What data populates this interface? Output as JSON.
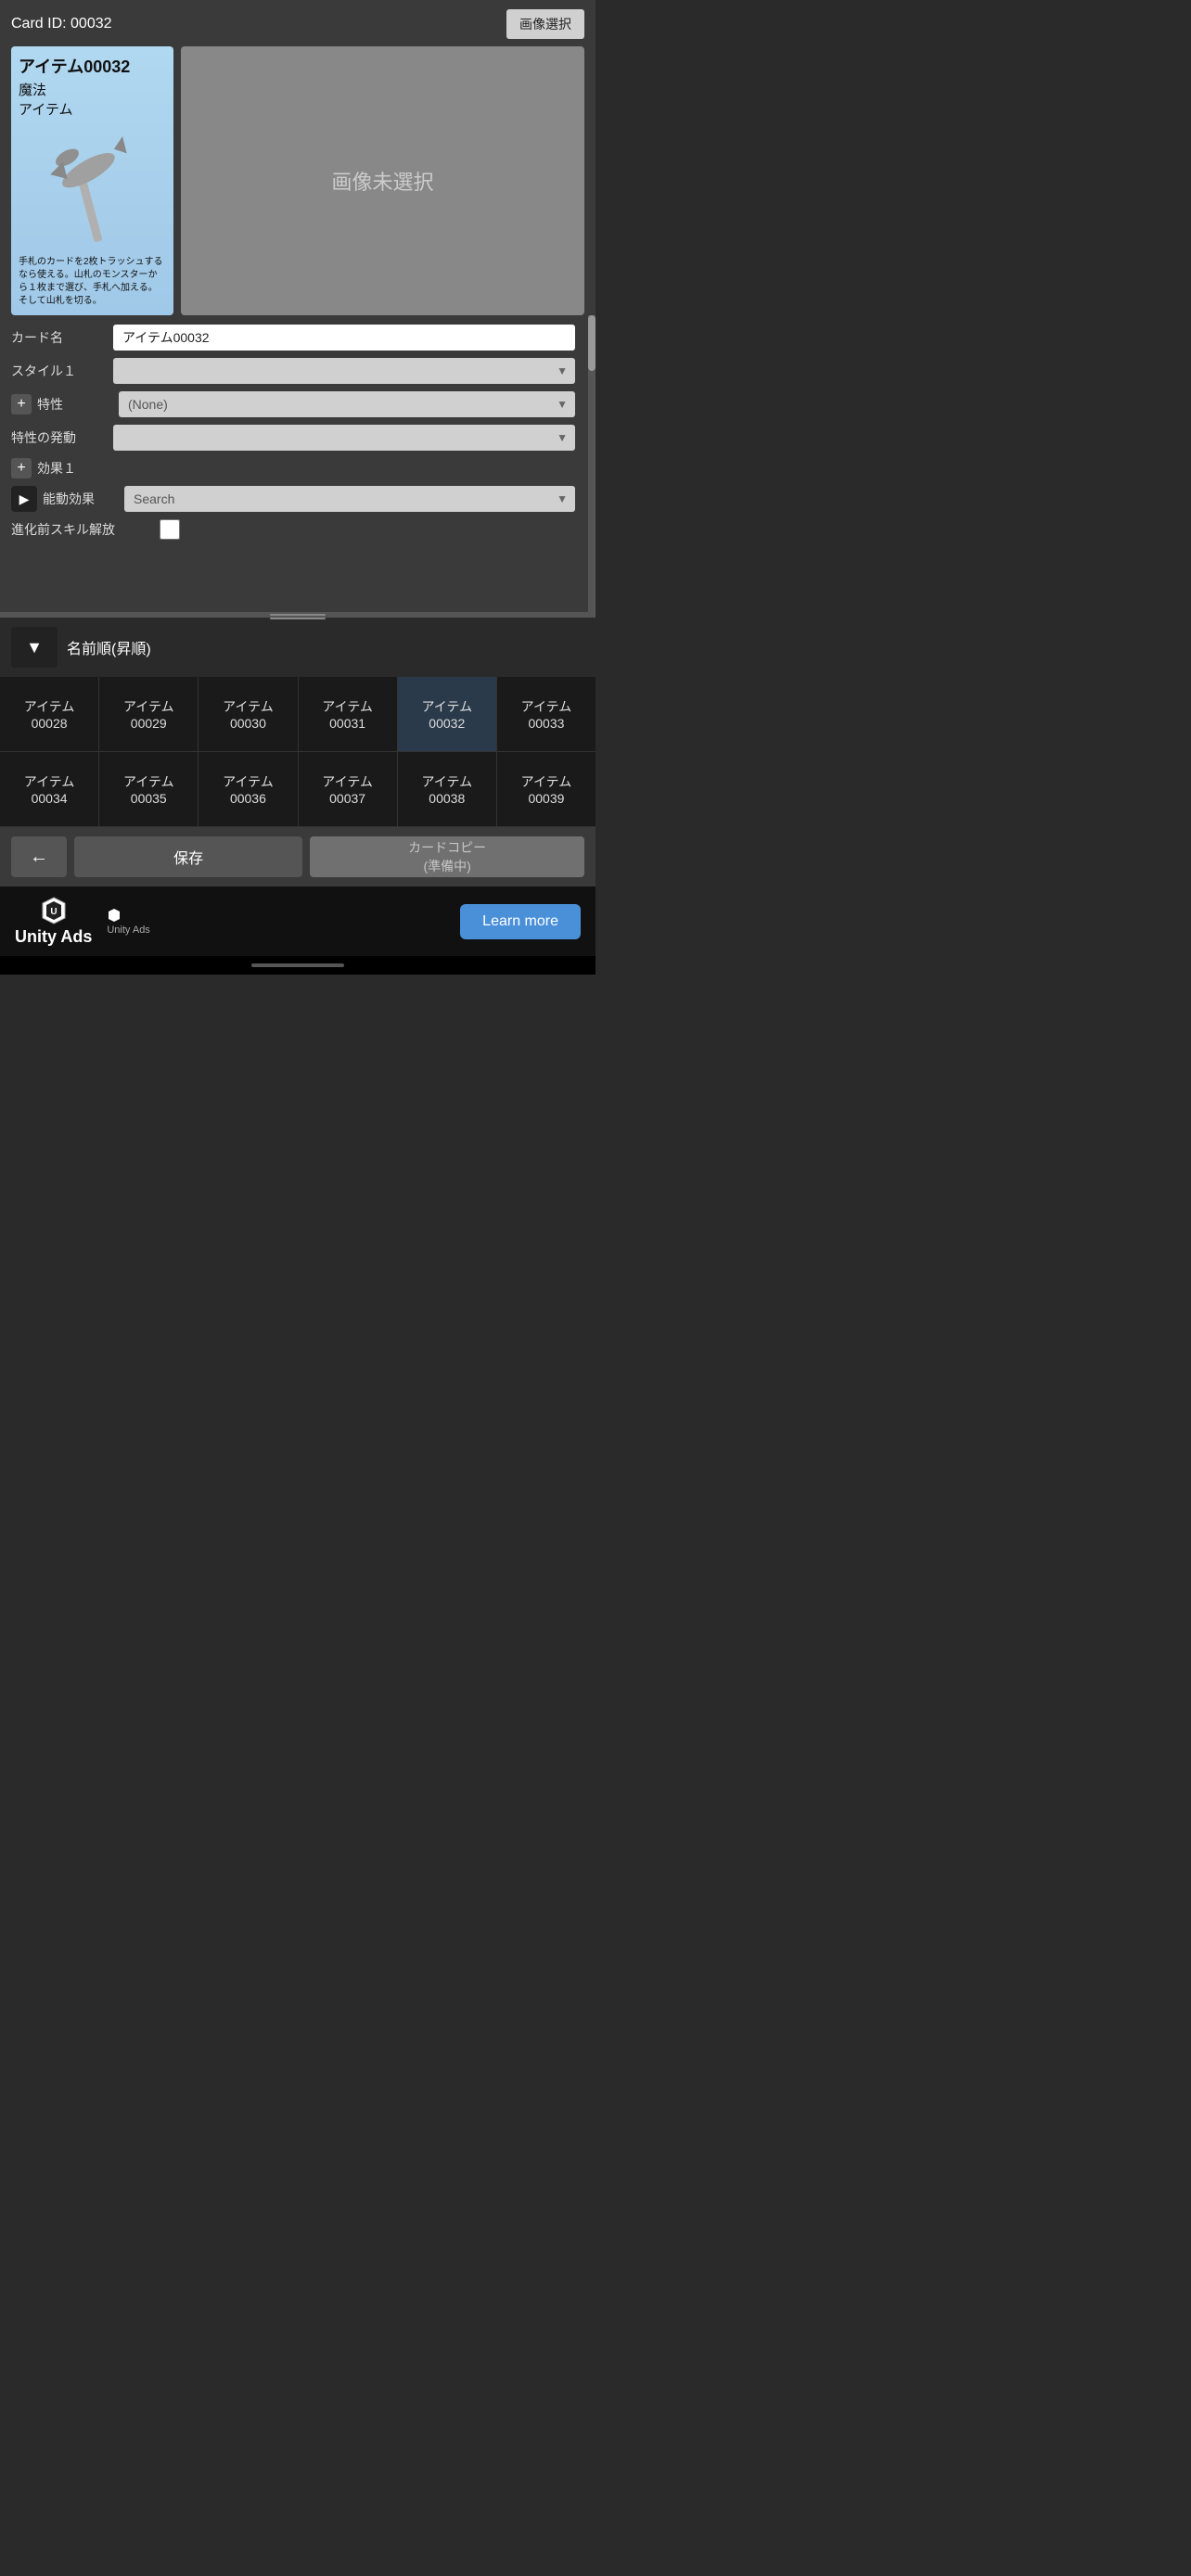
{
  "header": {
    "card_id_label": "Card ID: 00032",
    "image_select_btn": "画像選択"
  },
  "card_preview": {
    "title": "アイテム00032",
    "type1": "魔法",
    "type2": "アイテム",
    "description": "手札のカードを2枚トラッシュするなら使える。山札のモンスターから１枚まで選び、手札へ加える。そして山札を切る。",
    "no_image_text": "画像未選択"
  },
  "form": {
    "card_name_label": "カード名",
    "card_name_value": "アイテム00032",
    "style1_label": "スタイル１",
    "style1_placeholder": "",
    "trait_label": "特性",
    "trait_value": "(None)",
    "trait_trigger_label": "特性の発動",
    "trait_trigger_value": "",
    "effect1_label": "効果１",
    "passive_effect_label": "能動効果",
    "passive_effect_placeholder": "Search",
    "skill_release_label": "進化前スキル解放"
  },
  "sort": {
    "dropdown_arrow": "▼",
    "sort_label": "名前順(昇順)"
  },
  "grid": {
    "rows": [
      [
        {
          "text": "アイテム\n00028",
          "active": false
        },
        {
          "text": "アイテム\n00029",
          "active": false
        },
        {
          "text": "アイテム\n00030",
          "active": false
        },
        {
          "text": "アイテム\n00031",
          "active": false
        },
        {
          "text": "アイテム\n00032",
          "active": true
        },
        {
          "text": "アイテム\n00033",
          "active": false
        }
      ],
      [
        {
          "text": "アイテム\n00034",
          "active": false
        },
        {
          "text": "アイテム\n00035",
          "active": false
        },
        {
          "text": "アイテム\n00036",
          "active": false
        },
        {
          "text": "アイテム\n00037",
          "active": false
        },
        {
          "text": "アイテム\n00038",
          "active": false
        },
        {
          "text": "アイテム\n00039",
          "active": false
        }
      ]
    ]
  },
  "bottom_bar": {
    "back_arrow": "←",
    "save_label": "保存",
    "copy_label": "カードコピー\n(準備中)"
  },
  "ad": {
    "unity_ads_label": "Unity Ads",
    "unity_sub_label": "Unity  Ads",
    "learn_more_label": "Learn more"
  },
  "icons": {
    "play_icon": "▶",
    "plus_icon": "+",
    "chevron_down": "▼",
    "back_icon": "←"
  }
}
